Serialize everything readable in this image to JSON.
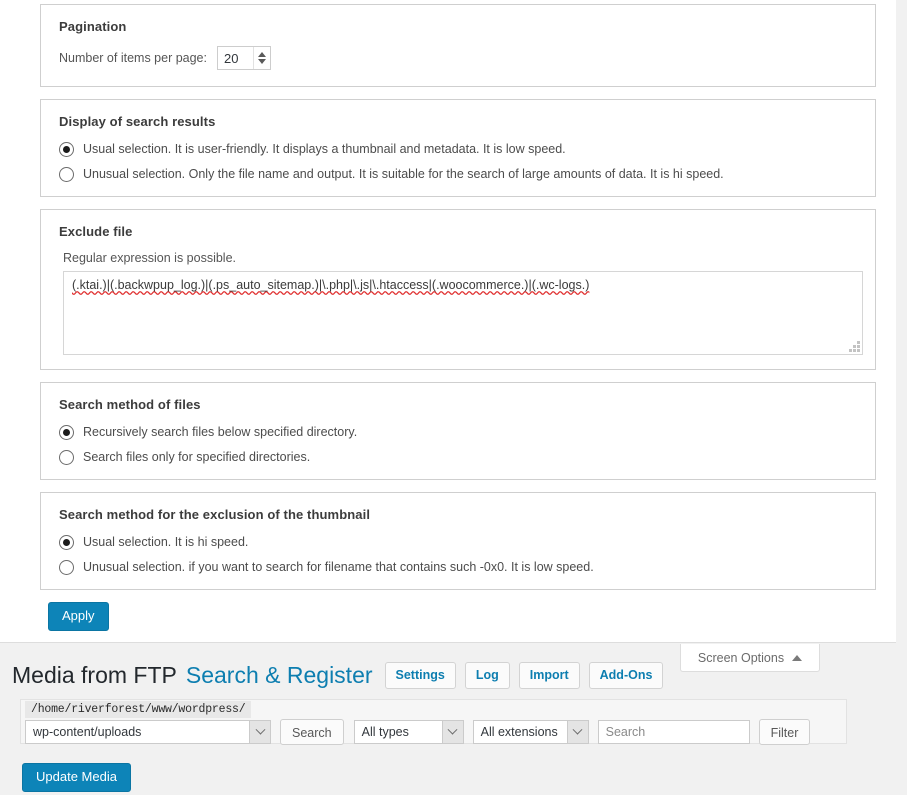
{
  "screen_options": {
    "tab_label": "Screen Options",
    "caret_icon": "triangle-up-icon",
    "pagination": {
      "title": "Pagination",
      "label": "Number of items per page:",
      "value": "20",
      "spinner_up_icon": "spinner-up-icon",
      "spinner_down_icon": "spinner-down-icon"
    },
    "display_results": {
      "title": "Display of search results",
      "options": [
        {
          "label": "Usual selection. It is user-friendly. It displays a thumbnail and metadata. It is low speed.",
          "checked": true
        },
        {
          "label": "Unusual selection. Only the file name and output. It is suitable for the search of large amounts of data. It is hi speed.",
          "checked": false
        }
      ]
    },
    "exclude_file": {
      "title": "Exclude file",
      "hint": "Regular expression is possible.",
      "value": "(.ktai.)|(.backwpup_log.)|(.ps_auto_sitemap.)|\\.php|\\.js|\\.htaccess|(.woocommerce.)|(.wc-logs.)",
      "resize_grip_icon": "resize-grip-icon"
    },
    "search_method_files": {
      "title": "Search method of files",
      "options": [
        {
          "label": "Recursively search files below specified directory.",
          "checked": true
        },
        {
          "label": "Search files only for specified directories.",
          "checked": false
        }
      ]
    },
    "search_method_thumbnail": {
      "title": "Search method for the exclusion of the thumbnail",
      "options": [
        {
          "label": "Usual selection. It is hi speed.",
          "checked": true
        },
        {
          "label": "Unusual selection. if you want to search for filename that contains such -0x0. It is low speed.",
          "checked": false
        }
      ]
    },
    "apply_label": "Apply"
  },
  "header": {
    "title_plugin": "Media from FTP",
    "title_page": "Search & Register",
    "buttons": [
      {
        "label": "Settings"
      },
      {
        "label": "Log"
      },
      {
        "label": "Import"
      },
      {
        "label": "Add-Ons"
      }
    ]
  },
  "filter_bar": {
    "base_path": "/home/riverforest/www/wordpress/",
    "directory_select": {
      "value": "wp-content/uploads",
      "arrow_icon": "chevron-down-icon"
    },
    "search_button": "Search",
    "type_select": {
      "value": "All types",
      "arrow_icon": "chevron-down-icon"
    },
    "extension_select": {
      "value": "All extensions",
      "arrow_icon": "chevron-down-icon"
    },
    "search_field": {
      "value": "",
      "placeholder": "Search"
    },
    "filter_button": "Filter"
  },
  "footer": {
    "update_media_label": "Update Media"
  },
  "colors": {
    "primary": "#0d84b8",
    "link": "#0d7eb0",
    "page_bg": "#f1f1f1",
    "panel_bg": "#ffffff",
    "spellcheck_underline": "#e03030"
  }
}
